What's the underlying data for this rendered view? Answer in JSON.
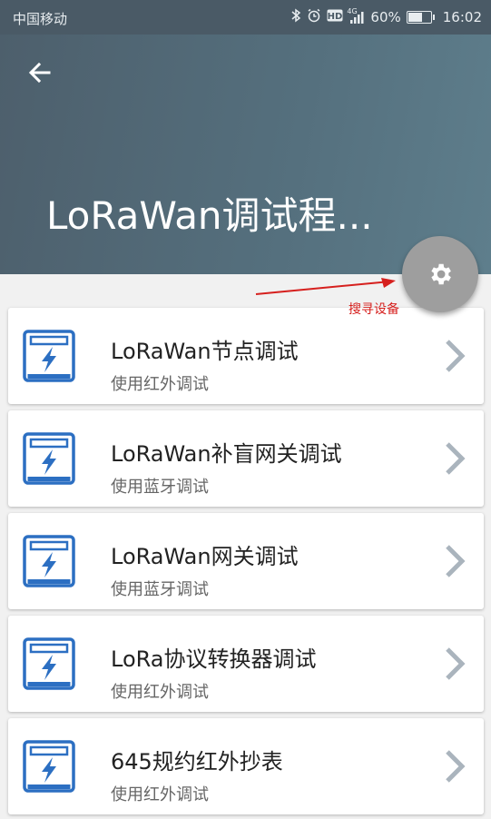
{
  "status_bar": {
    "carrier": "中国移动",
    "network_badge": "4G",
    "battery_percent": "60%",
    "battery_level": 0.6,
    "time": "16:02",
    "icons": [
      "bluetooth-icon",
      "alarm-icon",
      "hd-icon",
      "signal-icon",
      "battery-icon"
    ]
  },
  "header": {
    "title": "LoRaWan调试程...",
    "background_color": "#4f6470",
    "back_icon": "arrow-left-icon"
  },
  "fab": {
    "icon": "gear-icon",
    "color": "#9e9e9e"
  },
  "annotation": {
    "label": "搜寻设备",
    "color": "#d6201e"
  },
  "items": [
    {
      "title": "LoRaWan节点调试",
      "subtitle": "使用红外调试",
      "icon": "device-lightning-icon"
    },
    {
      "title": "LoRaWan补盲网关调试",
      "subtitle": "使用蓝牙调试",
      "icon": "device-lightning-icon"
    },
    {
      "title": "LoRaWan网关调试",
      "subtitle": "使用蓝牙调试",
      "icon": "device-lightning-icon"
    },
    {
      "title": "LoRa协议转换器调试",
      "subtitle": "使用红外调试",
      "icon": "device-lightning-icon"
    },
    {
      "title": "645规约红外抄表",
      "subtitle": "使用红外调试",
      "icon": "device-lightning-icon"
    }
  ]
}
